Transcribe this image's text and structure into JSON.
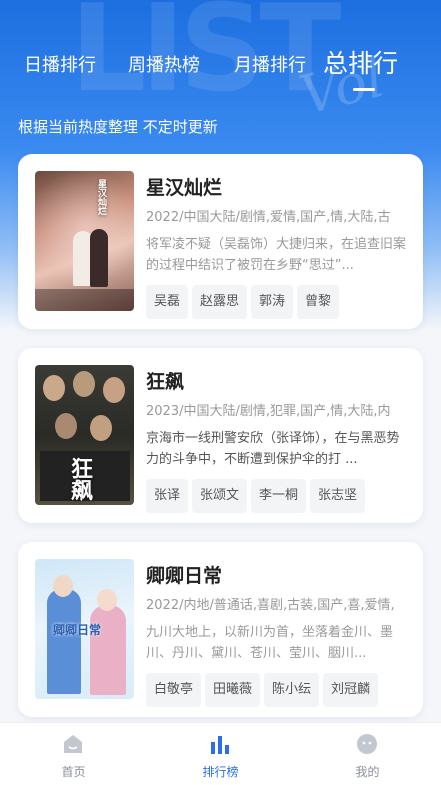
{
  "tabs": [
    "日播排行",
    "周播热榜",
    "月播排行",
    "总排行"
  ],
  "subtitle": "根据当前热度整理 不定时更新",
  "items": [
    {
      "title": "星汉灿烂",
      "meta": "2022/中国大陆/剧情,爱情,国产,情,大陆,古",
      "desc": "将军凌不疑（吴磊饰）大捷归来，在追查旧案的过程中结识了被罚在乡野“思过”...",
      "cast": [
        "吴磊",
        "赵露思",
        "郭涛",
        "曾黎"
      ],
      "poster_text": "星汉灿烂"
    },
    {
      "title": "狂飙",
      "meta": "2023/中国大陆/剧情,犯罪,国产,情,大陆,内",
      "desc": "京海市一线刑警安欣（张译饰），在与黑恶势力的斗争中，不断遭到保护伞的打 ...",
      "cast": [
        "张译",
        "张颂文",
        "李一桐",
        "张志坚"
      ],
      "poster_text": "狂飙"
    },
    {
      "title": "卿卿日常",
      "meta": "2022/内地/普通话,喜剧,古装,国产,喜,爱情,",
      "desc": "九川大地上，以新川为首，坐落着金川、墨川、丹川、黛川、苍川、莹川、胭川...",
      "cast": [
        "白敬亭",
        "田曦薇",
        "陈小纭",
        "刘冠麟"
      ],
      "poster_text": "卿卿日常"
    }
  ],
  "nav": [
    "首页",
    "排行榜",
    "我的"
  ],
  "colors": {
    "accent": "#2a6fe6",
    "hero_top": "#1d6fe0"
  }
}
